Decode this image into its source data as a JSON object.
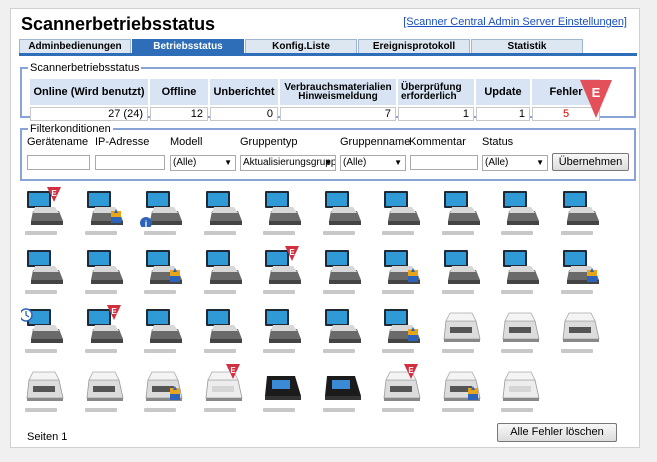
{
  "header": {
    "title": "Scannerbetriebsstatus",
    "link": "[Scanner Central Admin Server Einstellungen]"
  },
  "tabs": [
    {
      "label": "Adminbedienungen",
      "active": false
    },
    {
      "label": "Betriebsstatus",
      "active": true
    },
    {
      "label": "Konfig.Liste",
      "active": false
    },
    {
      "label": "Ereignisprotokoll",
      "active": false
    },
    {
      "label": "Statistik",
      "active": false
    }
  ],
  "status": {
    "legend": "Scannerbetriebsstatus",
    "headers": [
      "Online (Wird benutzt)",
      "Offline",
      "Unberichtet",
      "Verbrauchsmaterialien Hinweismeldung",
      "Überprüfung erforderlich",
      "Update",
      "Fehler"
    ],
    "values": [
      "27 (24)",
      "12",
      "0",
      "7",
      "1",
      "1",
      "5"
    ],
    "error_color": "#e00000",
    "badge_letter": "E"
  },
  "filter": {
    "legend": "Filterkonditionen",
    "labels": {
      "device": "Gerätename",
      "ip": "IP-Adresse",
      "model": "Modell",
      "group_type": "Gruppentyp",
      "group_name": "Gruppenname",
      "comment": "Kommentar",
      "status": "Status"
    },
    "values": {
      "device": "",
      "ip": "",
      "model": "(Alle)",
      "group_type": "Aktualisierungsgruppe",
      "group_name": "(Alle)",
      "comment": "",
      "status": "(Alle)"
    },
    "apply_label": "Übernehmen"
  },
  "devices": {
    "rows": [
      [
        "monitor-error",
        "monitor-update",
        "monitor-info",
        "monitor",
        "monitor",
        "monitor",
        "monitor",
        "monitor",
        "monitor",
        "monitor"
      ],
      [
        "monitor",
        "monitor",
        "monitor-update",
        "monitor",
        "monitor-error",
        "monitor",
        "monitor-update",
        "monitor",
        "monitor",
        "monitor-update"
      ],
      [
        "monitor-clock",
        "monitor-error",
        "monitor",
        "monitor",
        "monitor",
        "monitor",
        "monitor-update",
        "scanner",
        "scanner",
        "scanner"
      ],
      [
        "scanner",
        "scanner",
        "scanner-update",
        "scanner-error-faded",
        "scanner-black",
        "scanner-black",
        "scanner-error",
        "scanner-update",
        "scanner-faded"
      ]
    ]
  },
  "footer": {
    "pages": "Seiten 1",
    "clear_errors_label": "Alle Fehler löschen"
  }
}
